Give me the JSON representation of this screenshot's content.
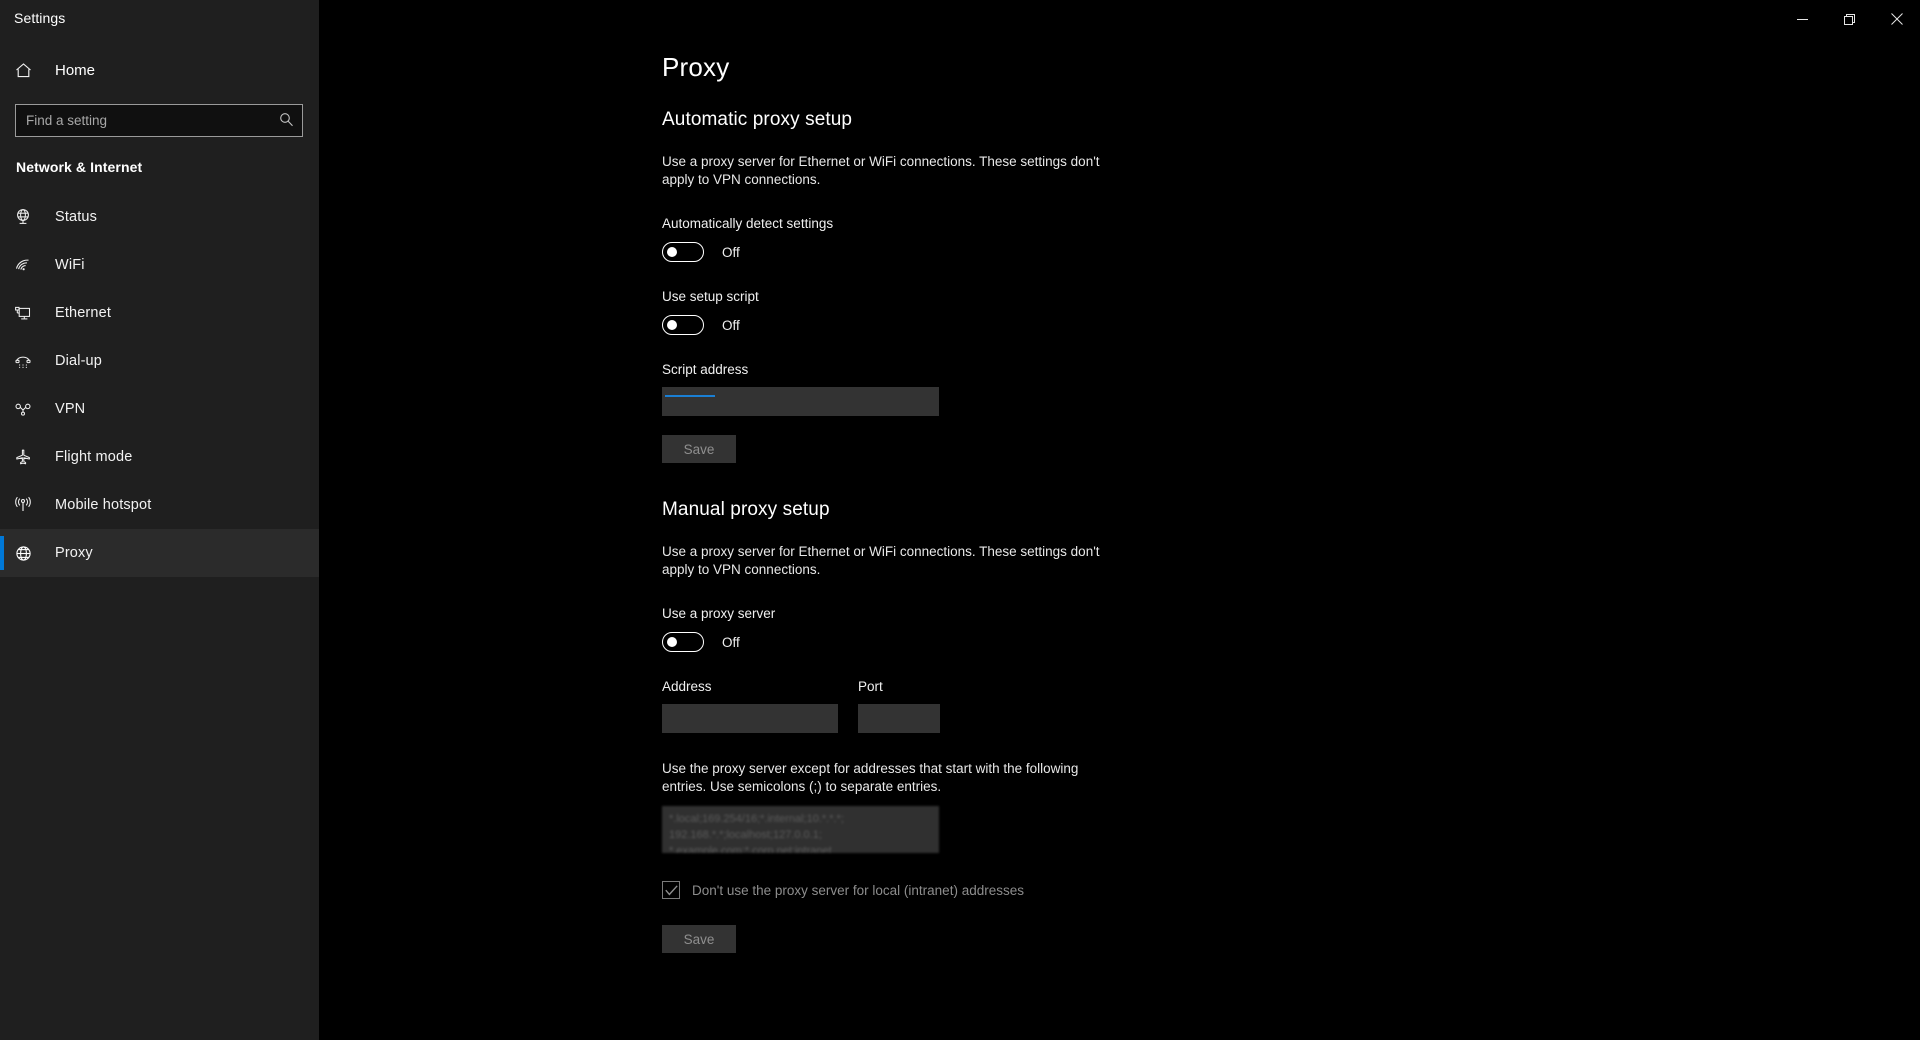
{
  "window": {
    "app_title": "Settings",
    "controls": {
      "minimize": "minimize-button",
      "restore": "restore-button",
      "close": "close-button"
    }
  },
  "sidebar": {
    "home_label": "Home",
    "search": {
      "placeholder": "Find a setting",
      "value": ""
    },
    "category": "Network & Internet",
    "items": [
      {
        "label": "Status",
        "icon": "globe-monitor-icon",
        "selected": false
      },
      {
        "label": "WiFi",
        "icon": "wifi-icon",
        "selected": false
      },
      {
        "label": "Ethernet",
        "icon": "ethernet-icon",
        "selected": false
      },
      {
        "label": "Dial-up",
        "icon": "dialup-icon",
        "selected": false
      },
      {
        "label": "VPN",
        "icon": "vpn-icon",
        "selected": false
      },
      {
        "label": "Flight mode",
        "icon": "airplane-icon",
        "selected": false
      },
      {
        "label": "Mobile hotspot",
        "icon": "hotspot-icon",
        "selected": false
      },
      {
        "label": "Proxy",
        "icon": "globe-icon",
        "selected": true
      }
    ]
  },
  "main": {
    "page_title": "Proxy",
    "automatic": {
      "heading": "Automatic proxy setup",
      "description": "Use a proxy server for Ethernet or WiFi connections. These settings don't apply to VPN connections.",
      "auto_detect_label": "Automatically detect settings",
      "auto_detect_state": "Off",
      "setup_script_label": "Use setup script",
      "setup_script_state": "Off",
      "script_address_label": "Script address",
      "script_address_value": "",
      "save_label": "Save"
    },
    "manual": {
      "heading": "Manual proxy setup",
      "description": "Use a proxy server for Ethernet or WiFi connections. These settings don't apply to VPN connections.",
      "use_proxy_label": "Use a proxy server",
      "use_proxy_state": "Off",
      "address_label": "Address",
      "address_value": "",
      "port_label": "Port",
      "port_value": "",
      "exceptions_description": "Use the proxy server except for addresses that start with the following entries. Use semicolons (;) to separate entries.",
      "exceptions_value": "*.local;169.254/16;*.internal;10.*.*.*;\n192.168.*.*;localhost;127.0.0.1;\n*.example.com;*.corp.net;intranet",
      "local_checkbox_label": "Don't use the proxy server for local (intranet) addresses",
      "local_checkbox_checked": true,
      "save_label": "Save"
    }
  },
  "colors": {
    "accent": "#0078d7",
    "sidebar_bg": "#1f1f1f",
    "content_bg": "#000000",
    "input_bg": "#333333",
    "selected_bg": "#2b2b2b"
  }
}
